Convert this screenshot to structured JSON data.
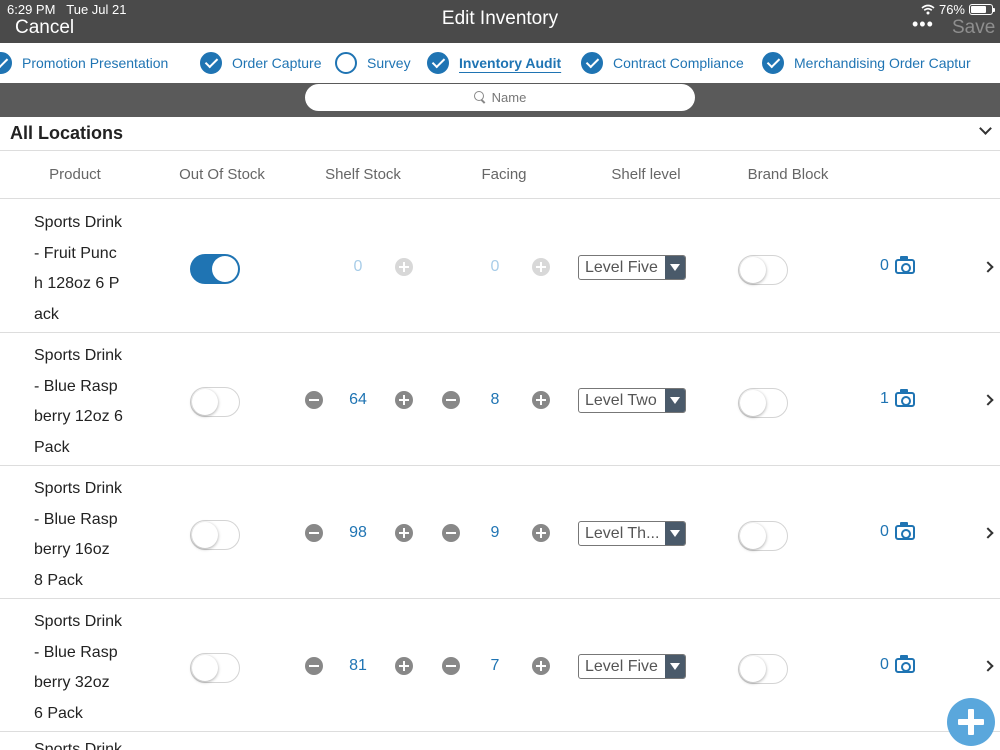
{
  "status_bar": {
    "time": "6:29 PM",
    "date": "Tue Jul 21",
    "battery": "76%"
  },
  "header": {
    "cancel_label": "Cancel",
    "title": "Edit Inventory",
    "more_label": "•••",
    "save_label": "Save"
  },
  "tabs": [
    {
      "label": "Promotion Presentation",
      "checked": true
    },
    {
      "label": "Order Capture",
      "checked": true
    },
    {
      "label": "Survey",
      "checked": false
    },
    {
      "label": "Inventory Audit",
      "checked": true,
      "active": true
    },
    {
      "label": "Contract Compliance",
      "checked": true
    },
    {
      "label": "Merchandising Order Captur",
      "checked": true
    }
  ],
  "search": {
    "placeholder": "Name"
  },
  "section": {
    "title": "All Locations"
  },
  "columns": [
    "Product",
    "Out Of Stock",
    "Shelf Stock",
    "Facing",
    "Shelf level",
    "Brand Block"
  ],
  "rows": [
    {
      "product_lines": [
        "Sports Drink",
        "- Fruit Punc",
        "h 128oz 6 P",
        "ack"
      ],
      "out_of_stock": true,
      "shelf_stock": "0",
      "facing": "0",
      "shelf_level": "Level Five",
      "brand_block": false,
      "photos": "0"
    },
    {
      "product_lines": [
        "Sports Drink",
        "- Blue Rasp",
        "berry 12oz 6",
        "Pack"
      ],
      "out_of_stock": false,
      "shelf_stock": "64",
      "facing": "8",
      "shelf_level": "Level Two",
      "brand_block": false,
      "photos": "1"
    },
    {
      "product_lines": [
        "Sports Drink",
        "- Blue Rasp",
        "berry 16oz",
        "8 Pack"
      ],
      "out_of_stock": false,
      "shelf_stock": "98",
      "facing": "9",
      "shelf_level": "Level Th...",
      "brand_block": false,
      "photos": "0"
    },
    {
      "product_lines": [
        "Sports Drink",
        "- Blue Rasp",
        "berry 32oz",
        "6 Pack"
      ],
      "out_of_stock": false,
      "shelf_stock": "81",
      "facing": "7",
      "shelf_level": "Level Five",
      "brand_block": false,
      "photos": "0"
    }
  ],
  "partial_row_text": "Sports Drink",
  "colors": {
    "header_bg": "#4a4a4a",
    "accent": "#1f74b3",
    "fab": "#5aa7dc"
  }
}
